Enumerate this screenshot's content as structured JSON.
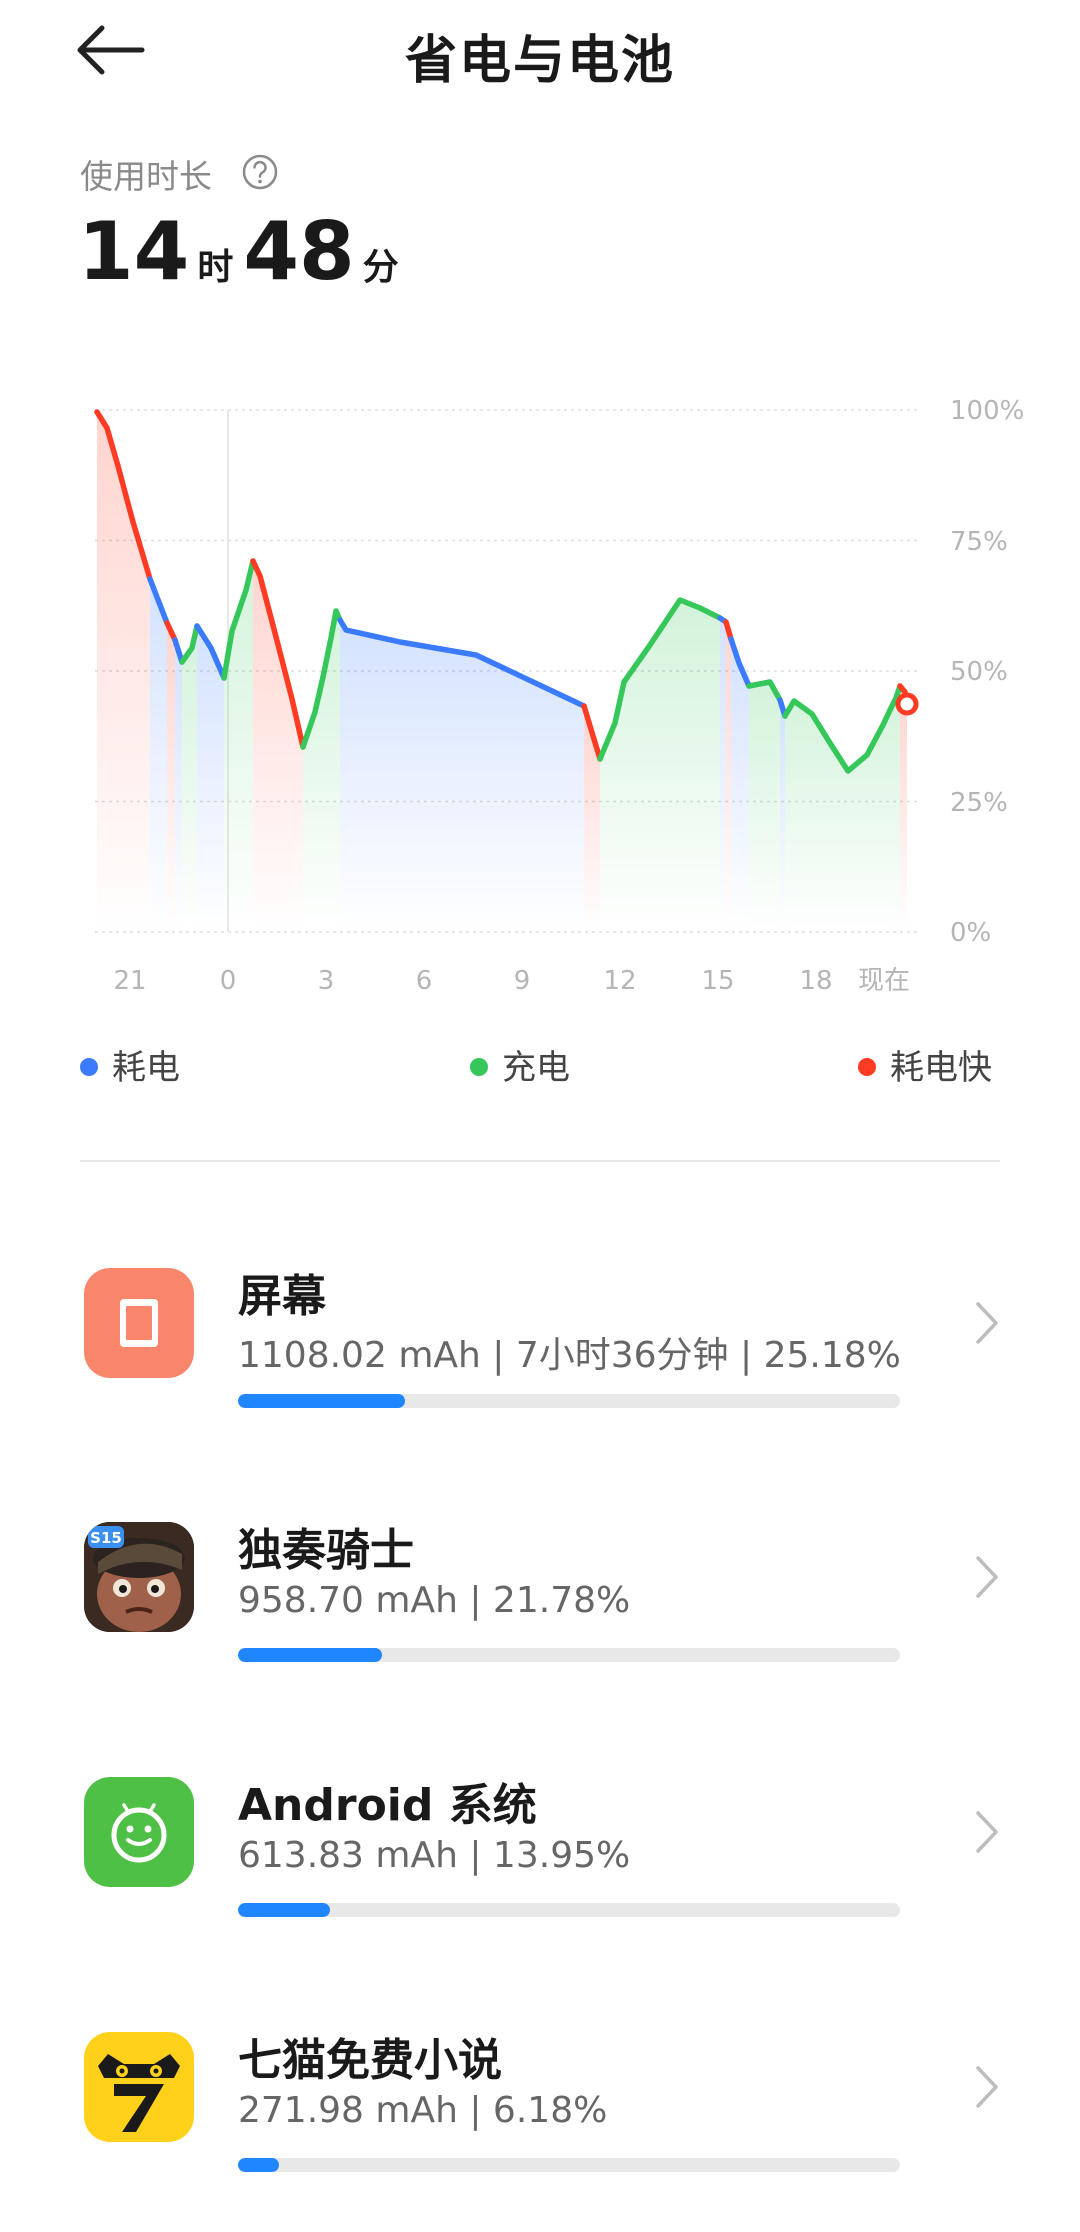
{
  "header": {
    "title": "省电与电池",
    "back_icon": "arrow-left-icon"
  },
  "usage": {
    "label": "使用时长",
    "help_icon": "question-circle-icon",
    "hours": "14",
    "hours_unit": "时",
    "minutes": "48",
    "minutes_unit": "分"
  },
  "chart": {
    "y_ticks": [
      "100%",
      "75%",
      "50%",
      "25%",
      "0%"
    ],
    "x_ticks": [
      "21",
      "0",
      "3",
      "6",
      "9",
      "12",
      "15",
      "18",
      "现在"
    ],
    "colors": {
      "drain": "#3a7bff",
      "charge": "#35c759",
      "fast_drain": "#ff3b24"
    }
  },
  "legend": [
    {
      "label": "耗电",
      "color": "#3a7bff"
    },
    {
      "label": "充电",
      "color": "#35c759"
    },
    {
      "label": "耗电快",
      "color": "#ff3b24"
    }
  ],
  "apps": [
    {
      "name": "屏幕",
      "detail": "1108.02 mAh | 7小时36分钟 | 25.18%",
      "percent": 25.18,
      "icon": "screen-icon"
    },
    {
      "name": "独奏骑士",
      "detail": "958.70 mAh | 21.78%",
      "percent": 21.78,
      "icon": "soul-knight-icon",
      "icon_text": "S15"
    },
    {
      "name": "Android 系统",
      "detail": "613.83 mAh | 13.95%",
      "percent": 13.95,
      "icon": "android-icon"
    },
    {
      "name": "七猫免费小说",
      "detail": "271.98 mAh | 6.18%",
      "percent": 6.18,
      "icon": "qimao-icon"
    }
  ]
}
